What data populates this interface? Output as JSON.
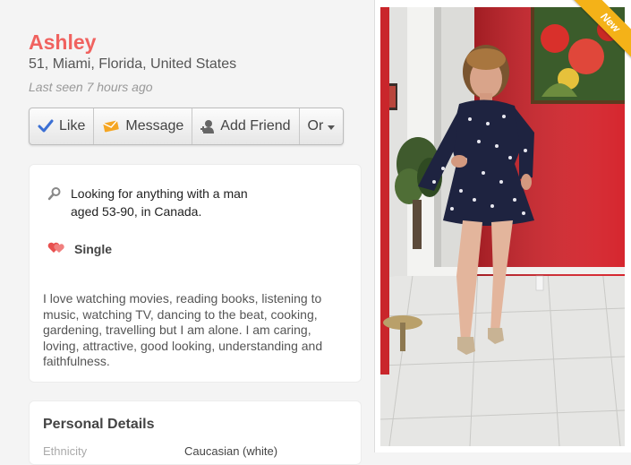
{
  "profile": {
    "name": "Ashley",
    "location": "51, Miami, Florida, United States",
    "last_seen": "Last seen 7 hours ago"
  },
  "actions": {
    "like": "Like",
    "message": "Message",
    "add_friend": "Add Friend",
    "more": "Or"
  },
  "looking_for": {
    "icon": "search-icon",
    "line1": "Looking for anything with a man",
    "line2": "aged 53-90, in Canada."
  },
  "relationship": {
    "icon": "hearts-icon",
    "status": "Single"
  },
  "bio": "I love watching movies, reading books, listening to music, watching TV, dancing to the beat, cooking, gardening, travelling but I am alone. I am caring, loving, attractive, good looking, understanding and faithfulness.",
  "personal_details": {
    "title": "Personal Details",
    "rows": [
      {
        "label": "Ethnicity",
        "value": "Caucasian (white)"
      }
    ]
  },
  "photo": {
    "badge": "New"
  },
  "colors": {
    "name": "#f0625f",
    "badge": "#f4b218",
    "like_icon": "#3b6fd4",
    "message_icon": "#f5a623",
    "hearts_icon": "#e8504f",
    "wall_red": "#d6262e"
  }
}
